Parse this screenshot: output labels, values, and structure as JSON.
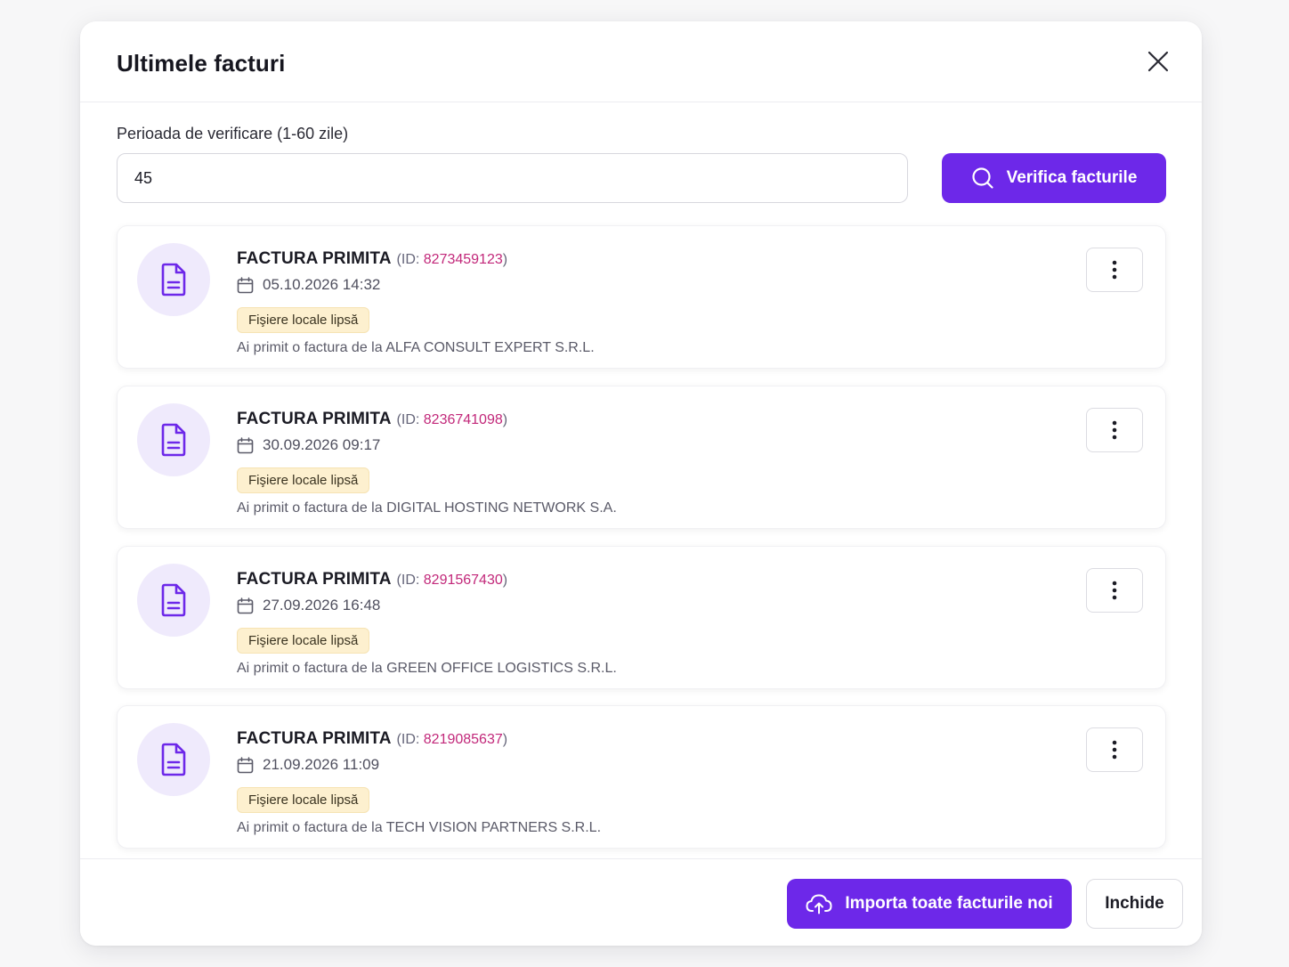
{
  "modal": {
    "title": "Ultimele facturi"
  },
  "period": {
    "label": "Perioada de verificare (1-60 zile)",
    "value": "45"
  },
  "verify_button": {
    "label": "Verifica facturile",
    "icon": "search-icon"
  },
  "invoices": [
    {
      "kind": "FACTURA PRIMITA",
      "id_prefix": "(ID: ",
      "id": "8273459123",
      "id_suffix": ")",
      "date": "05.10.2026 14:32",
      "badge": "Fişiere locale lipsă",
      "description": "Ai primit o factura de la ALFA CONSULT EXPERT S.R.L."
    },
    {
      "kind": "FACTURA PRIMITA",
      "id_prefix": "(ID: ",
      "id": "8236741098",
      "id_suffix": ")",
      "date": "30.09.2026 09:17",
      "badge": "Fişiere locale lipsă",
      "description": "Ai primit o factura de la DIGITAL HOSTING NETWORK S.A."
    },
    {
      "kind": "FACTURA PRIMITA",
      "id_prefix": "(ID: ",
      "id": "8291567430",
      "id_suffix": ")",
      "date": "27.09.2026 16:48",
      "badge": "Fişiere locale lipsă",
      "description": "Ai primit o factura de la GREEN OFFICE LOGISTICS S.R.L."
    },
    {
      "kind": "FACTURA PRIMITA",
      "id_prefix": "(ID: ",
      "id": "8219085637",
      "id_suffix": ")",
      "date": "21.09.2026 11:09",
      "badge": "Fişiere locale lipsă",
      "description": "Ai primit o factura de la TECH VISION PARTNERS S.R.L."
    }
  ],
  "footer": {
    "import_label": "Importa toate facturile noi",
    "import_icon": "cloud-upload-icon",
    "close_label": "Inchide"
  },
  "colors": {
    "accent": "#6d28e9",
    "id_text": "#c2287a",
    "badge_bg": "#fdf0cf",
    "icon_circle_bg": "#efeafc"
  }
}
